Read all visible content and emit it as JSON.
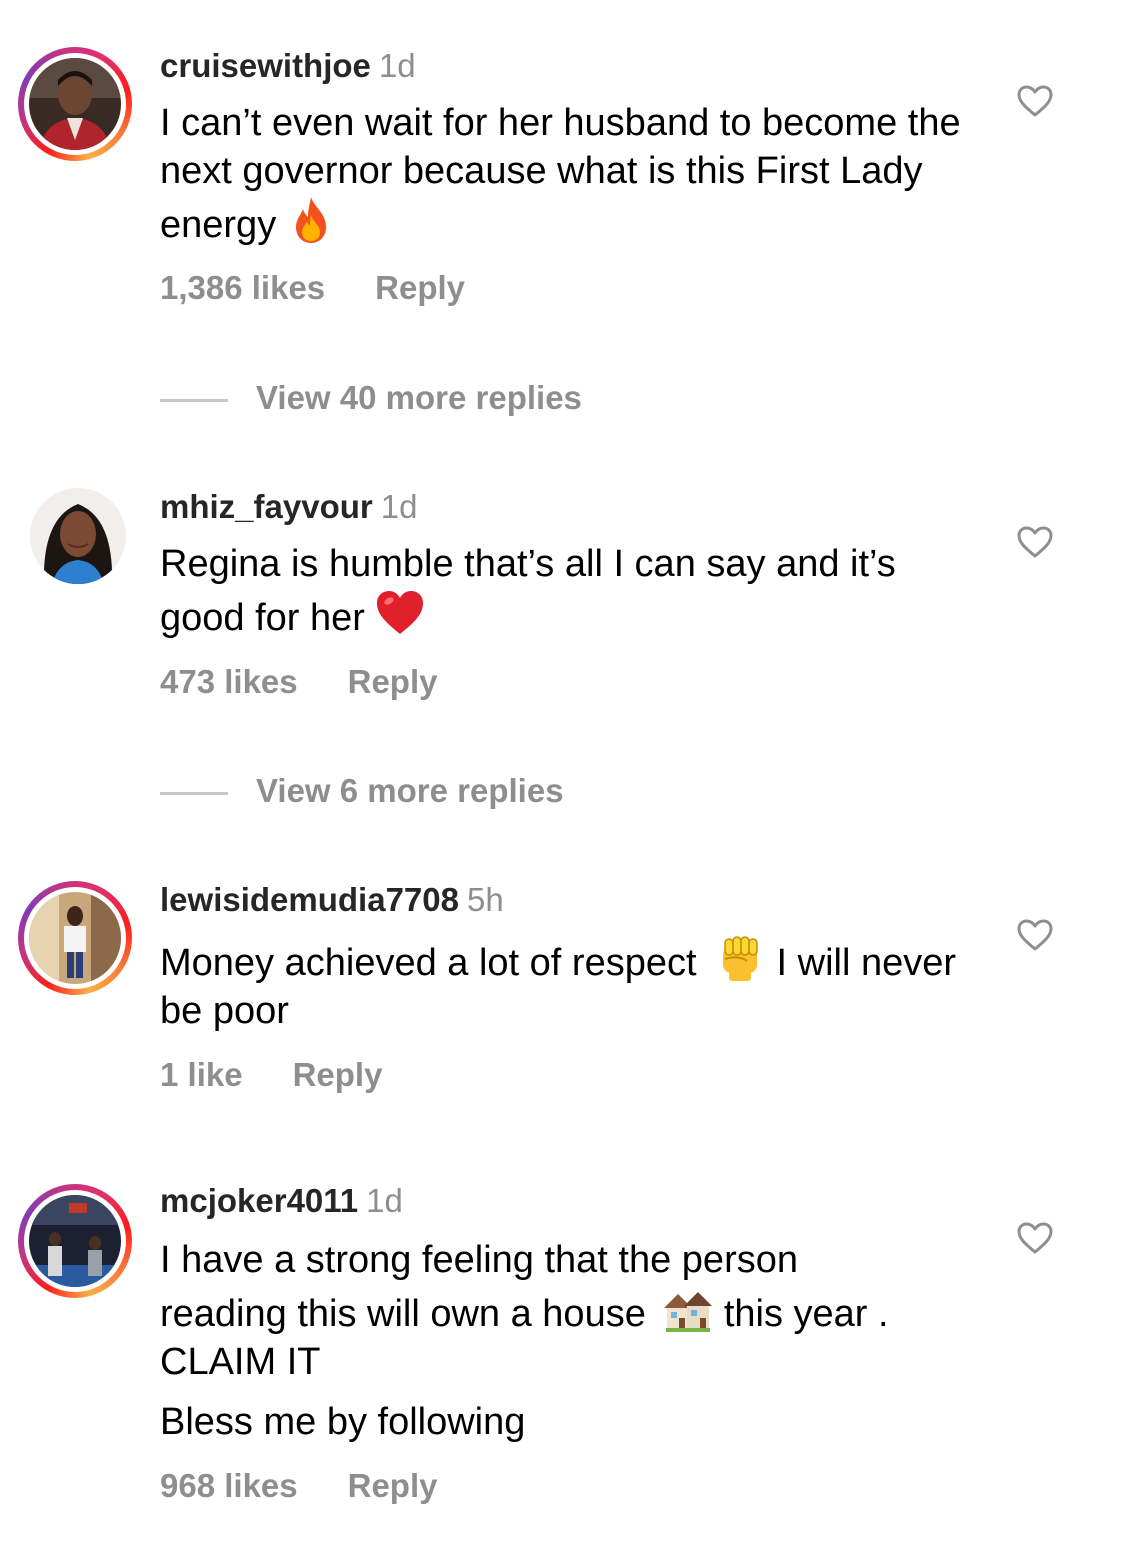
{
  "comments": [
    {
      "username": "cruisewithjoe",
      "time": "1d",
      "text_lines": [
        "I can’t even wait for her husband to become the next governor because what is this First Lady energy"
      ],
      "emoji": "fire",
      "likes": "1,386 likes",
      "reply_label": "Reply",
      "view_replies": "View 40 more replies"
    },
    {
      "username": "mhiz_fayvour",
      "time": "1d",
      "text_lines": [
        "Regina is humble that’s all I can say and it’s good for her"
      ],
      "emoji": "red-heart",
      "likes": "473 likes",
      "reply_label": "Reply",
      "view_replies": "View 6 more replies"
    },
    {
      "username": "lewisidemudia7708",
      "time": "5h",
      "text_a": "Money achieved a lot of respect",
      "emoji": "raised-fist",
      "text_b": "I will never be poor",
      "likes": "1 like",
      "reply_label": "Reply"
    },
    {
      "username": "mcjoker4011",
      "time": "1d",
      "text_a": "I have a strong feeling that the person reading this  will own a house",
      "emoji": "houses",
      "text_b": "this year .  CLAIM IT",
      "text_c": "Bless me by following",
      "likes": "968 likes",
      "reply_label": "Reply"
    }
  ],
  "colors": {
    "secondary_text": "#8e8e8e",
    "story_ring_start": "#fcaf45",
    "story_ring_end": "#c13584"
  },
  "icons": {
    "like": "heart-outline-icon"
  }
}
